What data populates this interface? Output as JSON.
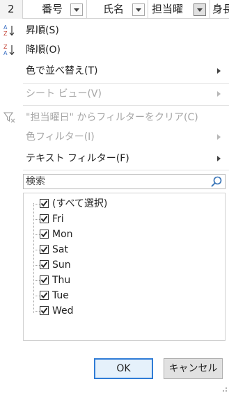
{
  "header": {
    "row_number": "2",
    "columns": [
      {
        "label": "番号",
        "filter_active": false
      },
      {
        "label": "氏名",
        "filter_active": false
      },
      {
        "label": "担当曜",
        "filter_active": true
      },
      {
        "label": "身長",
        "filter_active": false
      }
    ]
  },
  "menu": {
    "sort_asc": "昇順(S)",
    "sort_desc": "降順(O)",
    "sort_by_color": "色で並べ替え(T)",
    "sheet_view": "シート ビュー(V)",
    "clear_filter": "\"担当曜日\" からフィルターをクリア(C)",
    "color_filter": "色フィルター(I)",
    "text_filter": "テキスト フィルター(F)"
  },
  "search": {
    "placeholder": "検索"
  },
  "filter_list": [
    {
      "label": "(すべて選択)",
      "checked": true
    },
    {
      "label": "Fri",
      "checked": true
    },
    {
      "label": "Mon",
      "checked": true
    },
    {
      "label": "Sat",
      "checked": true
    },
    {
      "label": "Sun",
      "checked": true
    },
    {
      "label": "Thu",
      "checked": true
    },
    {
      "label": "Tue",
      "checked": true
    },
    {
      "label": "Wed",
      "checked": true
    }
  ],
  "buttons": {
    "ok": "OK",
    "cancel": "キャンセル"
  },
  "colors": {
    "accent": "#2f7cd6",
    "disabled_text": "#a6a6a6",
    "icon_blue": "#3a6fc4",
    "icon_red": "#c0392b"
  },
  "icons": [
    "sort-asc-icon",
    "sort-desc-icon",
    "clear-filter-icon",
    "search-icon",
    "submenu-arrow-icon",
    "checkbox-icon"
  ]
}
